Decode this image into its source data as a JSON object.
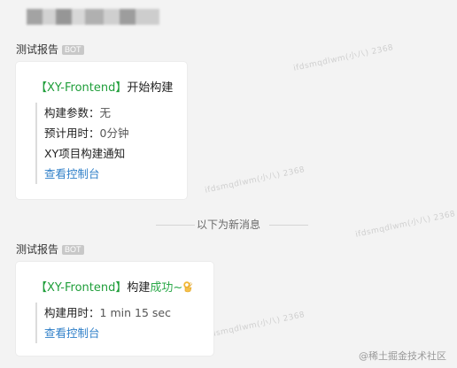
{
  "header": {
    "title_blurred": ""
  },
  "messages": [
    {
      "sender": "测试报告",
      "badge": "BOT",
      "title_tag": "【XY-Frontend】",
      "title_text": "开始构建",
      "rows": [
        {
          "label": "构建参数：",
          "value": "无"
        },
        {
          "label": "预计用时：",
          "value": "0分钟"
        },
        {
          "label": "XY项目构建通知",
          "value": ""
        }
      ],
      "link": "查看控制台"
    },
    {
      "sender": "测试报告",
      "badge": "BOT",
      "title_tag": "【XY-Frontend】",
      "title_text": "构建",
      "title_status": "成功~",
      "emoji_icon": "ok-hand-icon",
      "rows": [
        {
          "label": "构建用时：",
          "value": "1 min 15 sec"
        }
      ],
      "link": "查看控制台"
    }
  ],
  "divider": {
    "label": "以下为新消息"
  },
  "watermark": {
    "text": "ifdsmqdlwm(小八) 2368"
  },
  "credit": {
    "text": "@稀土掘金技术社区"
  },
  "colors": {
    "tag": "#1f9e3a",
    "success": "#2ca94a",
    "link": "#2f7fc8",
    "background": "#f3f3f3"
  }
}
